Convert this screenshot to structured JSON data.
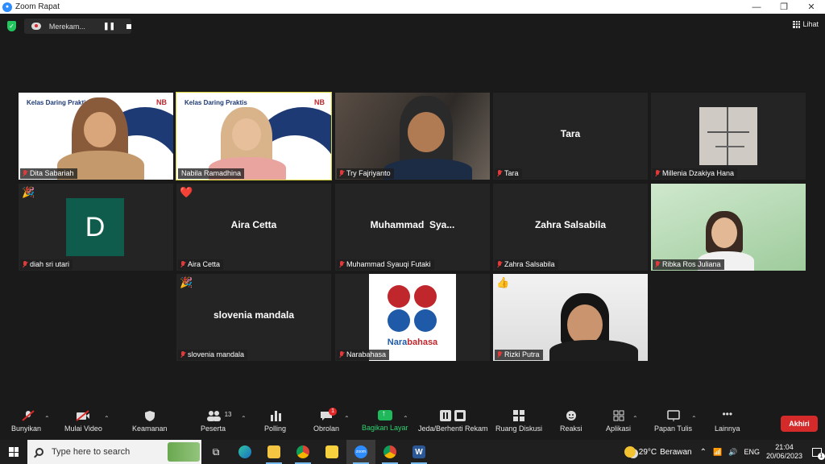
{
  "window": {
    "title": "Zoom Rapat",
    "controls": [
      "—",
      "❐",
      "✕"
    ]
  },
  "recording": {
    "label": "Merekam...",
    "pause": "❚❚"
  },
  "view": {
    "label": "Lihat"
  },
  "tiles": [
    {
      "name": "Dita Sabariah",
      "banner": "Kelas Daring Praktis",
      "logo": "NB"
    },
    {
      "name": "Nabila Ramadhina",
      "banner": "Kelas Daring Praktis",
      "logo": "NB"
    },
    {
      "name": "Try Fajriyanto"
    },
    {
      "name": "Tara",
      "display": "Tara"
    },
    {
      "name": "Millenia Dzakiya Hana"
    },
    {
      "name": "diah sri utari",
      "avatar_letter": "D",
      "reaction": "🎉"
    },
    {
      "name": "Aira Cetta",
      "display": "Aira Cetta",
      "reaction": "❤️"
    },
    {
      "name": "Muhammad Syauqi Futaki",
      "display": "Muhammad  Sya..."
    },
    {
      "name": "Zahra Salsabila",
      "display": "Zahra Salsabila"
    },
    {
      "name": "Ribka Ros Juliana"
    },
    {
      "name": "slovenia mandala",
      "display": "slovenia mandala",
      "reaction": "🎉"
    },
    {
      "name": "Narabahasa",
      "logo_a": "Nara",
      "logo_b": "bahasa"
    },
    {
      "name": "Rizki Putra",
      "reaction": "👍"
    }
  ],
  "toolbar": {
    "mute": "Bunyikan",
    "video": "Mulai Video",
    "security": "Keamanan",
    "participants": "Peserta",
    "participants_count": "13",
    "polling": "Polling",
    "chat": "Obrolan",
    "chat_badge": "1",
    "share": "Bagikan Layar",
    "record": "Jeda/Berhenti Rekam",
    "breakout": "Ruang Diskusi",
    "reactions": "Reaksi",
    "apps": "Aplikasi",
    "whiteboard": "Papan Tulis",
    "more": "Lainnya",
    "end": "Akhiri"
  },
  "taskbar": {
    "search_placeholder": "Type here to search",
    "zoom_label": "zoom",
    "word_label": "W",
    "temperature": "29°C",
    "weather": "Berawan",
    "lang": "ENG",
    "time": "21:04",
    "date": "20/06/2023",
    "notif_count": "1"
  },
  "colors": {
    "accent_green": "#23c55e",
    "end_red": "#d42a2a",
    "share_green": "#1fb85a",
    "active_border": "#d6d23a"
  }
}
